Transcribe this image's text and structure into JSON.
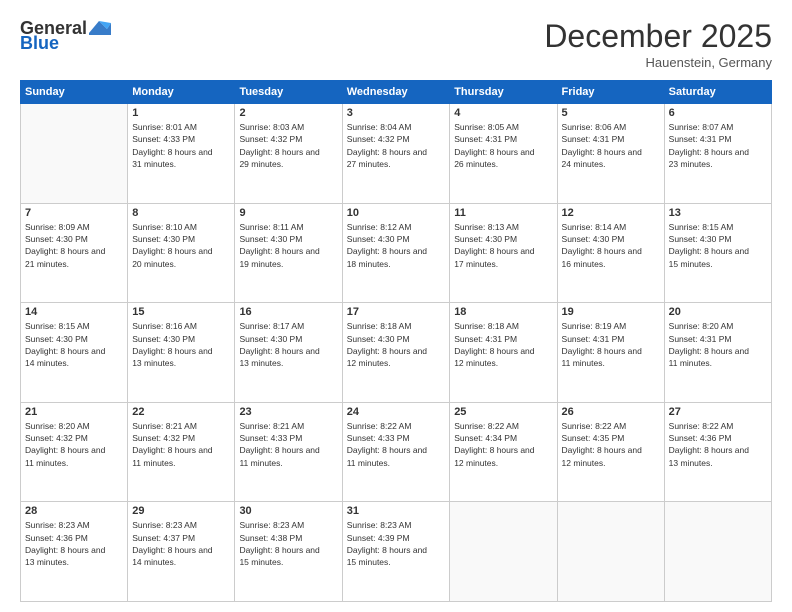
{
  "header": {
    "logo_general": "General",
    "logo_blue": "Blue",
    "month_title": "December 2025",
    "location": "Hauenstein, Germany"
  },
  "days_of_week": [
    "Sunday",
    "Monday",
    "Tuesday",
    "Wednesday",
    "Thursday",
    "Friday",
    "Saturday"
  ],
  "weeks": [
    [
      {
        "day": "",
        "sunrise": "",
        "sunset": "",
        "daylight": ""
      },
      {
        "day": "1",
        "sunrise": "Sunrise: 8:01 AM",
        "sunset": "Sunset: 4:33 PM",
        "daylight": "Daylight: 8 hours and 31 minutes."
      },
      {
        "day": "2",
        "sunrise": "Sunrise: 8:03 AM",
        "sunset": "Sunset: 4:32 PM",
        "daylight": "Daylight: 8 hours and 29 minutes."
      },
      {
        "day": "3",
        "sunrise": "Sunrise: 8:04 AM",
        "sunset": "Sunset: 4:32 PM",
        "daylight": "Daylight: 8 hours and 27 minutes."
      },
      {
        "day": "4",
        "sunrise": "Sunrise: 8:05 AM",
        "sunset": "Sunset: 4:31 PM",
        "daylight": "Daylight: 8 hours and 26 minutes."
      },
      {
        "day": "5",
        "sunrise": "Sunrise: 8:06 AM",
        "sunset": "Sunset: 4:31 PM",
        "daylight": "Daylight: 8 hours and 24 minutes."
      },
      {
        "day": "6",
        "sunrise": "Sunrise: 8:07 AM",
        "sunset": "Sunset: 4:31 PM",
        "daylight": "Daylight: 8 hours and 23 minutes."
      }
    ],
    [
      {
        "day": "7",
        "sunrise": "Sunrise: 8:09 AM",
        "sunset": "Sunset: 4:30 PM",
        "daylight": "Daylight: 8 hours and 21 minutes."
      },
      {
        "day": "8",
        "sunrise": "Sunrise: 8:10 AM",
        "sunset": "Sunset: 4:30 PM",
        "daylight": "Daylight: 8 hours and 20 minutes."
      },
      {
        "day": "9",
        "sunrise": "Sunrise: 8:11 AM",
        "sunset": "Sunset: 4:30 PM",
        "daylight": "Daylight: 8 hours and 19 minutes."
      },
      {
        "day": "10",
        "sunrise": "Sunrise: 8:12 AM",
        "sunset": "Sunset: 4:30 PM",
        "daylight": "Daylight: 8 hours and 18 minutes."
      },
      {
        "day": "11",
        "sunrise": "Sunrise: 8:13 AM",
        "sunset": "Sunset: 4:30 PM",
        "daylight": "Daylight: 8 hours and 17 minutes."
      },
      {
        "day": "12",
        "sunrise": "Sunrise: 8:14 AM",
        "sunset": "Sunset: 4:30 PM",
        "daylight": "Daylight: 8 hours and 16 minutes."
      },
      {
        "day": "13",
        "sunrise": "Sunrise: 8:15 AM",
        "sunset": "Sunset: 4:30 PM",
        "daylight": "Daylight: 8 hours and 15 minutes."
      }
    ],
    [
      {
        "day": "14",
        "sunrise": "Sunrise: 8:15 AM",
        "sunset": "Sunset: 4:30 PM",
        "daylight": "Daylight: 8 hours and 14 minutes."
      },
      {
        "day": "15",
        "sunrise": "Sunrise: 8:16 AM",
        "sunset": "Sunset: 4:30 PM",
        "daylight": "Daylight: 8 hours and 13 minutes."
      },
      {
        "day": "16",
        "sunrise": "Sunrise: 8:17 AM",
        "sunset": "Sunset: 4:30 PM",
        "daylight": "Daylight: 8 hours and 13 minutes."
      },
      {
        "day": "17",
        "sunrise": "Sunrise: 8:18 AM",
        "sunset": "Sunset: 4:30 PM",
        "daylight": "Daylight: 8 hours and 12 minutes."
      },
      {
        "day": "18",
        "sunrise": "Sunrise: 8:18 AM",
        "sunset": "Sunset: 4:31 PM",
        "daylight": "Daylight: 8 hours and 12 minutes."
      },
      {
        "day": "19",
        "sunrise": "Sunrise: 8:19 AM",
        "sunset": "Sunset: 4:31 PM",
        "daylight": "Daylight: 8 hours and 11 minutes."
      },
      {
        "day": "20",
        "sunrise": "Sunrise: 8:20 AM",
        "sunset": "Sunset: 4:31 PM",
        "daylight": "Daylight: 8 hours and 11 minutes."
      }
    ],
    [
      {
        "day": "21",
        "sunrise": "Sunrise: 8:20 AM",
        "sunset": "Sunset: 4:32 PM",
        "daylight": "Daylight: 8 hours and 11 minutes."
      },
      {
        "day": "22",
        "sunrise": "Sunrise: 8:21 AM",
        "sunset": "Sunset: 4:32 PM",
        "daylight": "Daylight: 8 hours and 11 minutes."
      },
      {
        "day": "23",
        "sunrise": "Sunrise: 8:21 AM",
        "sunset": "Sunset: 4:33 PM",
        "daylight": "Daylight: 8 hours and 11 minutes."
      },
      {
        "day": "24",
        "sunrise": "Sunrise: 8:22 AM",
        "sunset": "Sunset: 4:33 PM",
        "daylight": "Daylight: 8 hours and 11 minutes."
      },
      {
        "day": "25",
        "sunrise": "Sunrise: 8:22 AM",
        "sunset": "Sunset: 4:34 PM",
        "daylight": "Daylight: 8 hours and 12 minutes."
      },
      {
        "day": "26",
        "sunrise": "Sunrise: 8:22 AM",
        "sunset": "Sunset: 4:35 PM",
        "daylight": "Daylight: 8 hours and 12 minutes."
      },
      {
        "day": "27",
        "sunrise": "Sunrise: 8:22 AM",
        "sunset": "Sunset: 4:36 PM",
        "daylight": "Daylight: 8 hours and 13 minutes."
      }
    ],
    [
      {
        "day": "28",
        "sunrise": "Sunrise: 8:23 AM",
        "sunset": "Sunset: 4:36 PM",
        "daylight": "Daylight: 8 hours and 13 minutes."
      },
      {
        "day": "29",
        "sunrise": "Sunrise: 8:23 AM",
        "sunset": "Sunset: 4:37 PM",
        "daylight": "Daylight: 8 hours and 14 minutes."
      },
      {
        "day": "30",
        "sunrise": "Sunrise: 8:23 AM",
        "sunset": "Sunset: 4:38 PM",
        "daylight": "Daylight: 8 hours and 15 minutes."
      },
      {
        "day": "31",
        "sunrise": "Sunrise: 8:23 AM",
        "sunset": "Sunset: 4:39 PM",
        "daylight": "Daylight: 8 hours and 15 minutes."
      },
      {
        "day": "",
        "sunrise": "",
        "sunset": "",
        "daylight": ""
      },
      {
        "day": "",
        "sunrise": "",
        "sunset": "",
        "daylight": ""
      },
      {
        "day": "",
        "sunrise": "",
        "sunset": "",
        "daylight": ""
      }
    ]
  ]
}
